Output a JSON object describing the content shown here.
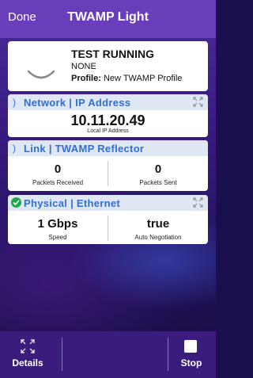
{
  "nav": {
    "done_label": "Done",
    "title": "TWAMP Light"
  },
  "status": {
    "title": "TEST RUNNING",
    "subtitle": "NONE",
    "profile_label": "Profile:",
    "profile_value": "New TWAMP Profile"
  },
  "network": {
    "header": "Network | IP Address",
    "ip_value": "10.11.20.49",
    "ip_label": "Local IP Address"
  },
  "link": {
    "header": "Link | TWAMP Reflector",
    "received_value": "0",
    "received_label": "Packets Received",
    "sent_value": "0",
    "sent_label": "Packets Sent"
  },
  "physical": {
    "header": "Physical | Ethernet",
    "speed_value": "1 Gbps",
    "speed_label": "Speed",
    "autoneg_value": "true",
    "autoneg_label": "Auto Negotiation"
  },
  "toolbar": {
    "details_label": "Details",
    "stop_label": "Stop"
  },
  "icons": {
    "chevron": "chevron-right-icon",
    "expand": "expand-icon",
    "check": "check-circle-icon",
    "stop": "stop-icon"
  },
  "colors": {
    "nav_background": "#6a3dbb",
    "section_header_text": "#2f6fd6",
    "section_header_background": "#dfe6f4",
    "check_green": "#21a84a",
    "toolbar_background": "#3a1c7d"
  }
}
